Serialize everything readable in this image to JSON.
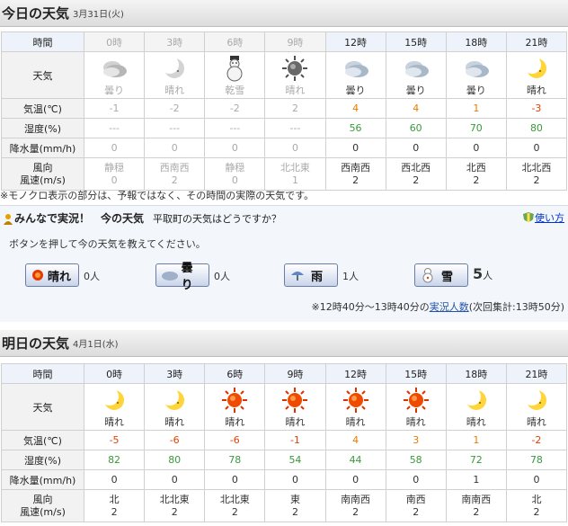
{
  "today": {
    "title": "今日の天気",
    "date": "3月31日(火)",
    "hours": [
      "0時",
      "3時",
      "6時",
      "9時",
      "12時",
      "15時",
      "18時",
      "21時"
    ],
    "weather": [
      {
        "icon": "cloud-icon",
        "label": "曇り"
      },
      {
        "icon": "moon-icon",
        "label": "晴れ"
      },
      {
        "icon": "snowman-icon",
        "label": "乾雪"
      },
      {
        "icon": "sun-icon",
        "label": "晴れ"
      },
      {
        "icon": "cloud-icon",
        "label": "曇り"
      },
      {
        "icon": "cloud-icon",
        "label": "曇り"
      },
      {
        "icon": "cloud-icon",
        "label": "曇り"
      },
      {
        "icon": "moon-icon",
        "label": "晴れ"
      }
    ],
    "temp": [
      "-1",
      "-2",
      "-2",
      "2",
      "4",
      "4",
      "1",
      "-3"
    ],
    "humidity": [
      "---",
      "---",
      "---",
      "---",
      "56",
      "60",
      "70",
      "80"
    ],
    "precip": [
      "0",
      "0",
      "0",
      "0",
      "0",
      "0",
      "0",
      "0"
    ],
    "wind_dir": [
      "静穏",
      "西南西",
      "静穏",
      "北北東",
      "西南西",
      "西北西",
      "北西",
      "北北西"
    ],
    "wind_speed": [
      "0",
      "2",
      "0",
      "1",
      "2",
      "2",
      "2",
      "2"
    ]
  },
  "tomorrow": {
    "title": "明日の天気",
    "date": "4月1日(水)",
    "hours": [
      "0時",
      "3時",
      "6時",
      "9時",
      "12時",
      "15時",
      "18時",
      "21時"
    ],
    "weather": [
      {
        "icon": "moon-icon",
        "label": "晴れ"
      },
      {
        "icon": "moon-icon",
        "label": "晴れ"
      },
      {
        "icon": "sun-icon",
        "label": "晴れ"
      },
      {
        "icon": "sun-icon",
        "label": "晴れ"
      },
      {
        "icon": "sun-icon",
        "label": "晴れ"
      },
      {
        "icon": "sun-icon",
        "label": "晴れ"
      },
      {
        "icon": "moon-icon",
        "label": "晴れ"
      },
      {
        "icon": "moon-icon",
        "label": "晴れ"
      }
    ],
    "temp": [
      "-5",
      "-6",
      "-6",
      "-1",
      "4",
      "3",
      "1",
      "-2"
    ],
    "humidity": [
      "82",
      "80",
      "78",
      "54",
      "44",
      "58",
      "72",
      "78"
    ],
    "precip": [
      "0",
      "0",
      "0",
      "0",
      "0",
      "0",
      "1",
      "0"
    ],
    "wind_dir": [
      "北",
      "北北東",
      "北北東",
      "東",
      "南南西",
      "南西",
      "南南西",
      "北"
    ],
    "wind_speed": [
      "2",
      "2",
      "2",
      "2",
      "2",
      "2",
      "2",
      "2"
    ]
  },
  "row_labels": {
    "time": "時間",
    "weather": "天気",
    "temp": "気温(℃)",
    "humidity": "湿度(%)",
    "precip": "降水量(mm/h)",
    "wind_dir": "風向",
    "wind_speed": "風速(m/s)"
  },
  "note": "※モノクロ表示の部分は、予報ではなく、その時間の実際の天気です。",
  "jikkyo": {
    "title": "みんなで実況！　今の天気",
    "question": "平取町の天気はどうですか？",
    "help": "使い方",
    "instruction": "ボタンを押して今の天気を教えてください。",
    "buttons": [
      {
        "label": "晴れ",
        "count": "0",
        "unit": "人"
      },
      {
        "label": "曇り",
        "count": "0",
        "unit": "人"
      },
      {
        "label": "雨",
        "count": "1",
        "unit": "人"
      },
      {
        "label": "雪",
        "count": "5",
        "unit": "人"
      }
    ],
    "footer_prefix": "※12時40分〜13時40分の",
    "footer_link": "実況人数",
    "footer_suffix": "(次回集計:13時50分)"
  },
  "colors": {
    "temp_hi": "#e87a00",
    "temp_lo": "#e84000",
    "humidity": "#3a9a3a"
  }
}
